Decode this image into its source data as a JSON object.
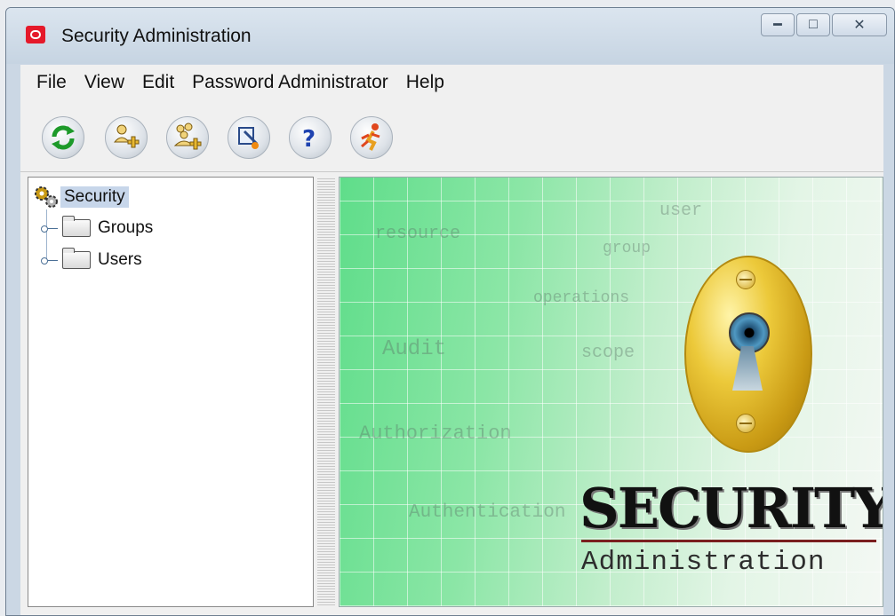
{
  "window": {
    "title": "Security Administration",
    "controls": {
      "minimize_icon": "minimize-icon",
      "maximize_icon": "maximize-icon",
      "close_icon": "close-icon"
    }
  },
  "menu": {
    "items": [
      {
        "label": "File"
      },
      {
        "label": "View"
      },
      {
        "label": "Edit"
      },
      {
        "label": "Password Administrator"
      },
      {
        "label": "Help"
      }
    ]
  },
  "toolbar": {
    "buttons": [
      {
        "icon": "refresh-icon"
      },
      {
        "icon": "add-user-icon"
      },
      {
        "icon": "add-group-icon"
      },
      {
        "icon": "edit-icon"
      },
      {
        "icon": "help-icon"
      },
      {
        "icon": "exit-icon"
      }
    ]
  },
  "tree": {
    "root": {
      "label": "Security",
      "icon": "security-gears-icon",
      "selected": true
    },
    "nodes": [
      {
        "label": "Groups",
        "icon": "folder-icon"
      },
      {
        "label": "Users",
        "icon": "folder-icon"
      }
    ]
  },
  "banner": {
    "words": [
      "user",
      "resource",
      "group",
      "operations",
      "Audit",
      "scope",
      "Authorization",
      "Authentication"
    ],
    "title": "SECURITY",
    "subtitle": "Administration"
  },
  "colors": {
    "selection": "#c7d6ea",
    "banner_green": "#5fdd8a",
    "keyhole_gold": "#ecc93a",
    "title_bar": "#cbd7e4"
  }
}
